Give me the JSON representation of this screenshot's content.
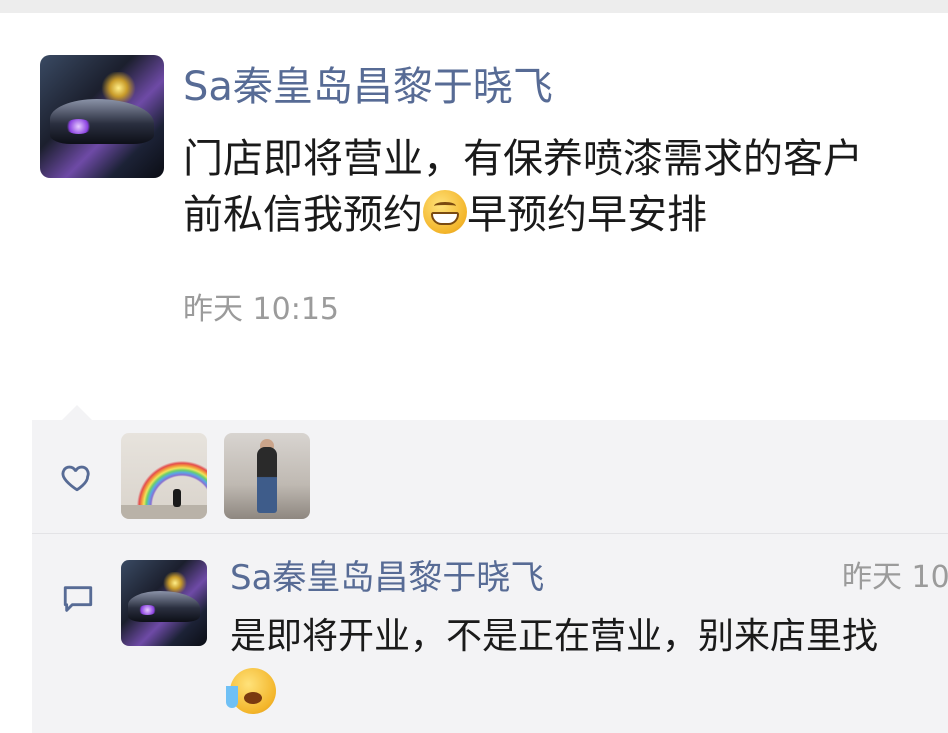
{
  "post": {
    "author": "Sa秦皇岛昌黎于晓飞",
    "text_line1": "门店即将营业，有保养喷漆需求的客户",
    "text_line2_before_emoji": "前私信我预约",
    "text_line2_after_emoji": "早预约早安排",
    "emoji_inline": "grinning-face-emoji",
    "time": "昨天 10:15"
  },
  "likes": {
    "icon": "heart-icon",
    "avatars": [
      "rainbow-avatar",
      "person-in-store-avatar"
    ]
  },
  "comment": {
    "icon": "comment-icon",
    "author": "Sa秦皇岛昌黎于晓飞",
    "time": "昨天 10",
    "text": "是即将开业，不是正在营业，别来店里找",
    "emoji": "loudly-crying-face-emoji"
  },
  "colors": {
    "name_blue": "#576b95",
    "time_gray": "#9b9b9b",
    "panel_bg": "#f3f3f5",
    "text": "#1a1a1a"
  }
}
